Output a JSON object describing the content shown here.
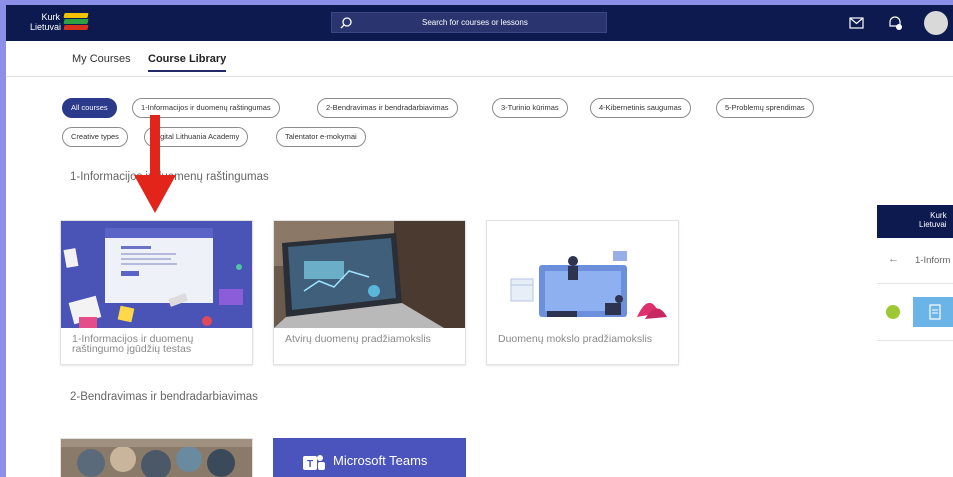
{
  "header": {
    "logo_line1": "Kurk",
    "logo_line2": "Lietuvai",
    "logo_colors": [
      "#f2c200",
      "#2ea043",
      "#d9301c"
    ],
    "search_placeholder": "Search for courses or lessons",
    "icons": [
      "search-icon",
      "mail-icon",
      "notifications-icon",
      "avatar"
    ]
  },
  "tabs": [
    {
      "label": "My Courses",
      "active": false
    },
    {
      "label": "Course Library",
      "active": true
    }
  ],
  "filters": [
    {
      "label": "All courses",
      "active": true
    },
    {
      "label": "1-Informacijos ir duomenų raštingumas",
      "active": false
    },
    {
      "label": "2-Bendravimas ir bendradarbiavimas",
      "active": false
    },
    {
      "label": "3-Turinio kūrimas",
      "active": false
    },
    {
      "label": "4-Kibernetinis saugumas",
      "active": false
    },
    {
      "label": "5-Problemų sprendimas",
      "active": false
    },
    {
      "label": "Creative types",
      "active": false
    },
    {
      "label": "Digital Lithuania Academy",
      "active": false
    },
    {
      "label": "Talentator e-mokymai",
      "active": false
    }
  ],
  "sections": [
    {
      "title": "1-Informacijos ir duomenų raštingumas",
      "cards": [
        {
          "title": "1-Informacijos ir duomenų raštingumo įgūdžių testas",
          "image": "test-screen-illustration"
        },
        {
          "title": "Atvirų duomenų pradžiamokslis",
          "image": "laptop-analytics-photo"
        },
        {
          "title": "Duomenų mokslo pradžiamokslis",
          "image": "data-people-illustration"
        }
      ]
    },
    {
      "title": "2-Bendravimas ir bendradarbiavimas",
      "cards": [
        {
          "title": "",
          "image": "group-photo"
        },
        {
          "title": "Microsoft Teams",
          "image": "microsoft-teams-banner"
        }
      ]
    }
  ],
  "side_panel": {
    "logo_line1": "Kurk",
    "logo_line2": "Lietuvai",
    "breadcrumb": "1-Inform"
  },
  "annotation": {
    "type": "red-arrow",
    "color": "#e3241b"
  },
  "colors": {
    "navy": "#0d1a4f",
    "accent": "#2c3a8c",
    "frame": "#8b8fe8"
  }
}
